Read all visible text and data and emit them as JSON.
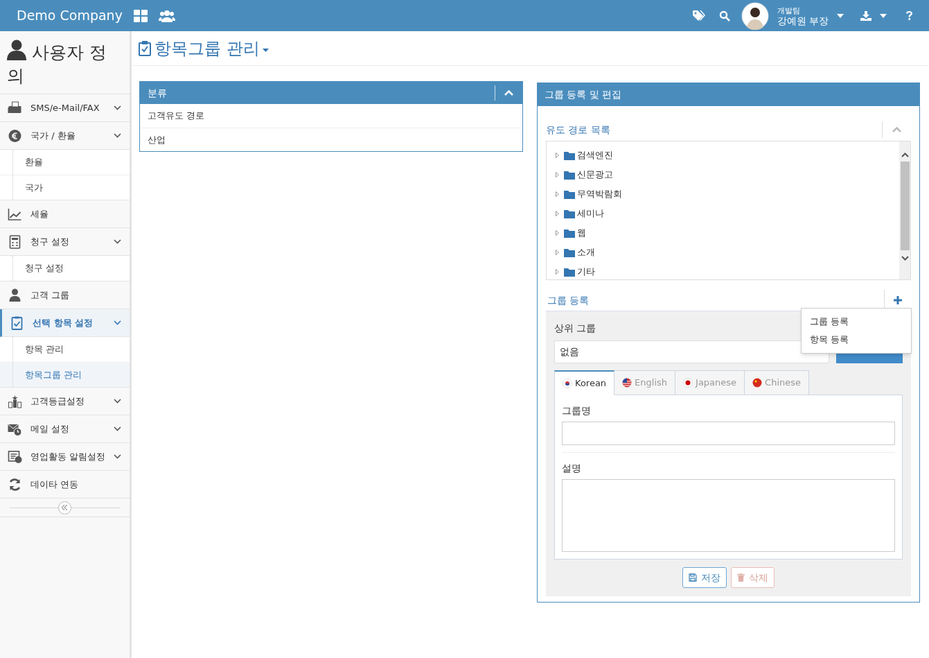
{
  "header": {
    "company": "Demo Company",
    "user": {
      "team": "개발팀",
      "name": "강예원 부장"
    }
  },
  "sidebar": {
    "title": "사용자 정의",
    "items": [
      {
        "label": "SMS/e-Mail/FAX",
        "selected": false,
        "kind": "group"
      },
      {
        "label": "국가 / 환율",
        "selected": false,
        "kind": "group",
        "children": [
          {
            "label": "환율",
            "selected": false
          },
          {
            "label": "국가",
            "selected": false
          }
        ]
      },
      {
        "label": "세율",
        "selected": false
      },
      {
        "label": "청구 설정",
        "selected": false,
        "kind": "group",
        "children": [
          {
            "label": "청구 설정",
            "selected": false
          }
        ]
      },
      {
        "label": "고객 그룹",
        "selected": false
      },
      {
        "label": "선택 항목 설정",
        "selected": true,
        "kind": "group",
        "children": [
          {
            "label": "항목 관리",
            "selected": false
          },
          {
            "label": "항목그룹 관리",
            "selected": true
          }
        ]
      },
      {
        "label": "고객등급설정",
        "selected": false,
        "kind": "group"
      },
      {
        "label": "메일 설정",
        "selected": false,
        "kind": "group"
      },
      {
        "label": "영업활동 알림설정",
        "selected": false,
        "kind": "group"
      },
      {
        "label": "데이타 연동",
        "selected": false
      }
    ]
  },
  "page_title": "항목그룹 관리",
  "category_panel": {
    "title": "분류",
    "rows": [
      "고객유도 경로",
      "산업"
    ]
  },
  "edit_panel": {
    "title": "그룹 등록 및 편집",
    "tree_title": "유도 경로 목록",
    "tree": [
      "검색엔진",
      "신문광고",
      "무역박람회",
      "세미나",
      "웹",
      "소개",
      "기타"
    ],
    "register_title": "그룹 등록",
    "menu": [
      "그룹 등록",
      "항목 등록"
    ],
    "parent_label": "상위 그룹",
    "parent_value": "없음",
    "tabs": [
      {
        "label": "Korean",
        "selected": true
      },
      {
        "label": "English",
        "selected": false
      },
      {
        "label": "Japanese",
        "selected": false
      },
      {
        "label": "Chinese",
        "selected": false
      }
    ],
    "fields": [
      {
        "label": "그룹명",
        "kind": "input"
      },
      {
        "label": "설명",
        "kind": "textarea"
      }
    ],
    "buttons": [
      {
        "label": "저장",
        "kind": "save"
      },
      {
        "label": "삭제",
        "kind": "delete"
      }
    ]
  }
}
